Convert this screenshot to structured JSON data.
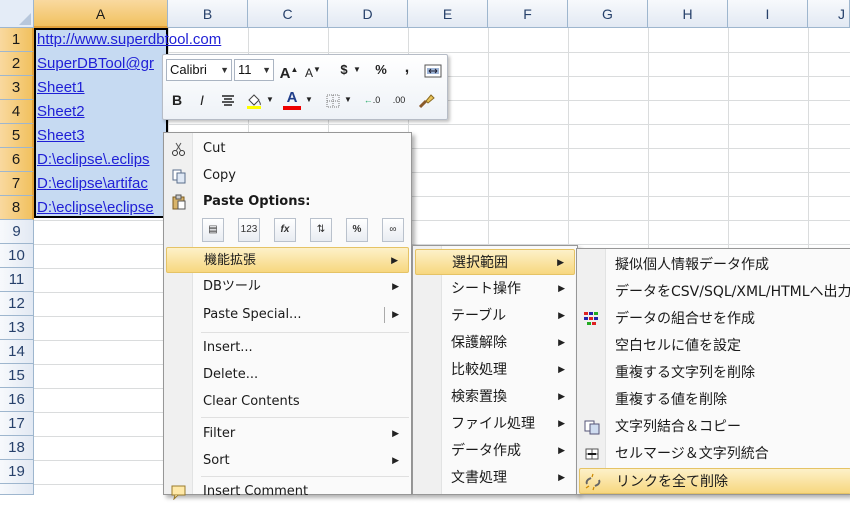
{
  "grid": {
    "columns": [
      "A",
      "B",
      "C",
      "D",
      "E",
      "F",
      "G",
      "H",
      "I",
      "J"
    ],
    "rows": [
      "1",
      "2",
      "3",
      "4",
      "5",
      "6",
      "7",
      "8",
      "9",
      "10",
      "11",
      "12",
      "13",
      "14",
      "15",
      "16",
      "17",
      "18",
      "19"
    ],
    "cells": [
      "http://www.superdbtool.com",
      "SuperDBTool@gr",
      "Sheet1",
      "Sheet2",
      "Sheet3",
      "D:\\eclipse\\.eclips",
      "D:\\eclipse\\artifac",
      "D:\\eclipse\\eclipse"
    ]
  },
  "mini_toolbar": {
    "font_name": "Calibri",
    "font_size": "11",
    "grow_font": "A",
    "shrink_font": "A",
    "currency": "$",
    "percent": "%",
    "comma": ",",
    "bold": "B",
    "italic": "I",
    "font_color_letter": "A",
    "dec_increase": ".0",
    "dec_decrease": ".00"
  },
  "context_menu": {
    "cut": "Cut",
    "copy": "Copy",
    "paste_options": "Paste Options:",
    "paste_icons": [
      "",
      "123",
      "fx",
      "",
      "%",
      ""
    ],
    "ext": "機能拡張",
    "db_tools": "DBツール",
    "paste_special": "Paste Special...",
    "insert": "Insert...",
    "delete": "Delete...",
    "clear_contents": "Clear Contents",
    "filter": "Filter",
    "sort": "Sort",
    "insert_comment": "Insert Comment"
  },
  "submenu1": [
    "選択範囲",
    "シート操作",
    "テーブル",
    "保護解除",
    "比較処理",
    "検索置換",
    "ファイル処理",
    "データ作成",
    "文書処理"
  ],
  "submenu2": [
    "擬似個人情報データ作成",
    "データをCSV/SQL/XML/HTMLへ出力",
    "データの組合せを作成",
    "空白セルに値を設定",
    "重複する文字列を削除",
    "重複する値を削除",
    "文字列結合＆コピー",
    "セルマージ＆文字列統合",
    "リンクを全て削除"
  ],
  "colors": {
    "selection_fill": "#c6daf2",
    "highlight": "#f7d77f",
    "header_selected": "#f1c15f",
    "link_blue": "#1f1fd6"
  }
}
